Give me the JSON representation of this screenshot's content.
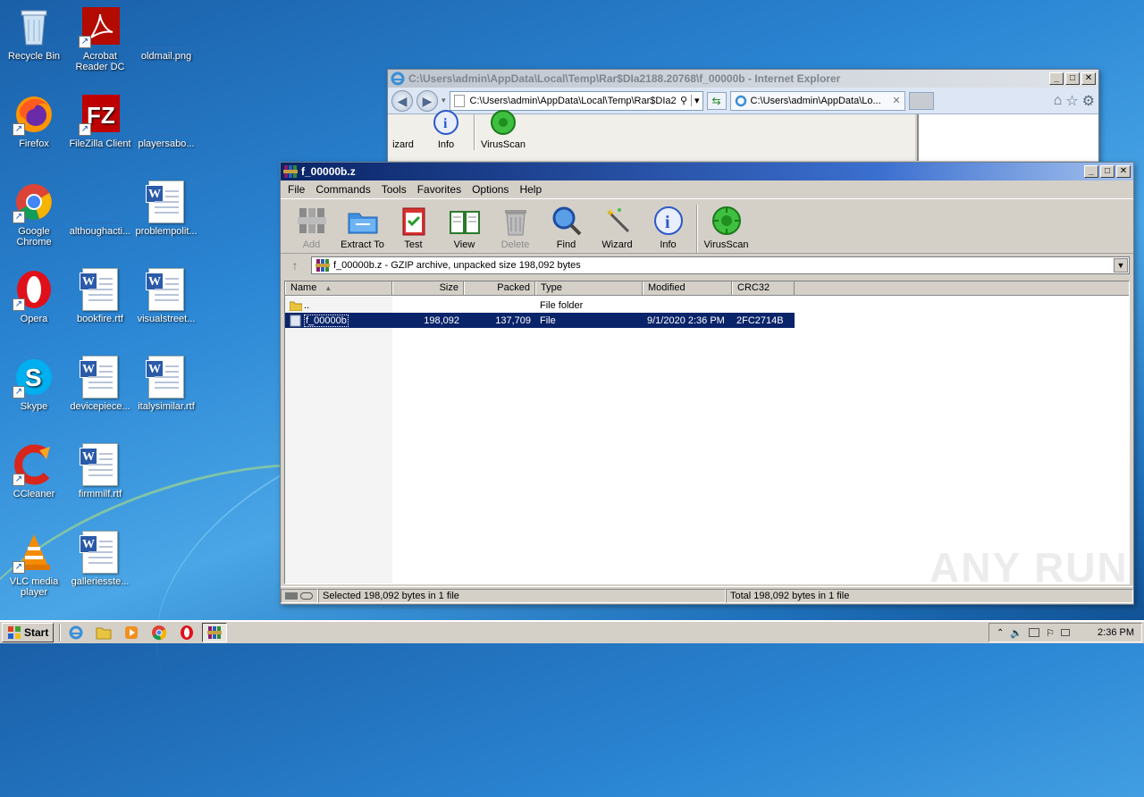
{
  "desktop": {
    "icons": [
      {
        "label": "Recycle Bin"
      },
      {
        "label": "Acrobat Reader DC"
      },
      {
        "label": "oldmail.png"
      },
      {
        "label": "Firefox"
      },
      {
        "label": "FileZilla Client"
      },
      {
        "label": "playersabo..."
      },
      {
        "label": "Google Chrome"
      },
      {
        "label": "althoughacti..."
      },
      {
        "label": "problempolit..."
      },
      {
        "label": "Opera"
      },
      {
        "label": "bookfire.rtf"
      },
      {
        "label": "visualstreet..."
      },
      {
        "label": "Skype"
      },
      {
        "label": "devicepiece..."
      },
      {
        "label": "italysimilar.rtf"
      },
      {
        "label": "CCleaner"
      },
      {
        "label": "firmmilf.rtf"
      },
      {
        "label": "VLC media player"
      },
      {
        "label": "galleriesste..."
      }
    ]
  },
  "ie": {
    "title": "C:\\Users\\admin\\AppData\\Local\\Temp\\Rar$DIa2188.20768\\f_00000b - Internet Explorer",
    "address": "C:\\Users\\admin\\AppData\\Local\\Temp\\Rar$DIa2",
    "tab_label": "C:\\Users\\admin\\AppData\\Lo...",
    "tab_close": "✕",
    "toolbar": [
      "izard",
      "Info",
      "VirusScan"
    ]
  },
  "winrar": {
    "title": "f_00000b.z",
    "menu": [
      "File",
      "Commands",
      "Tools",
      "Favorites",
      "Options",
      "Help"
    ],
    "toolbar": {
      "add": "Add",
      "extract": "Extract To",
      "test": "Test",
      "view": "View",
      "delete": "Delete",
      "find": "Find",
      "wizard": "Wizard",
      "info": "Info",
      "virusscan": "VirusScan"
    },
    "path": "f_00000b.z - GZIP archive, unpacked size 198,092 bytes",
    "columns": [
      "Name",
      "Size",
      "Packed",
      "Type",
      "Modified",
      "CRC32"
    ],
    "rows": [
      {
        "name": "..",
        "size": "",
        "packed": "",
        "type": "File folder",
        "modified": "",
        "crc": ""
      },
      {
        "name": "f_00000b",
        "size": "198,092",
        "packed": "137,709",
        "type": "File",
        "modified": "9/1/2020 2:36 PM",
        "crc": "2FC2714B"
      }
    ],
    "status_left": "Selected 198,092 bytes in 1 file",
    "status_right": "Total 198,092 bytes in 1 file"
  },
  "taskbar": {
    "start": "Start",
    "clock": "2:36 PM"
  },
  "watermark": "ANY RUN"
}
